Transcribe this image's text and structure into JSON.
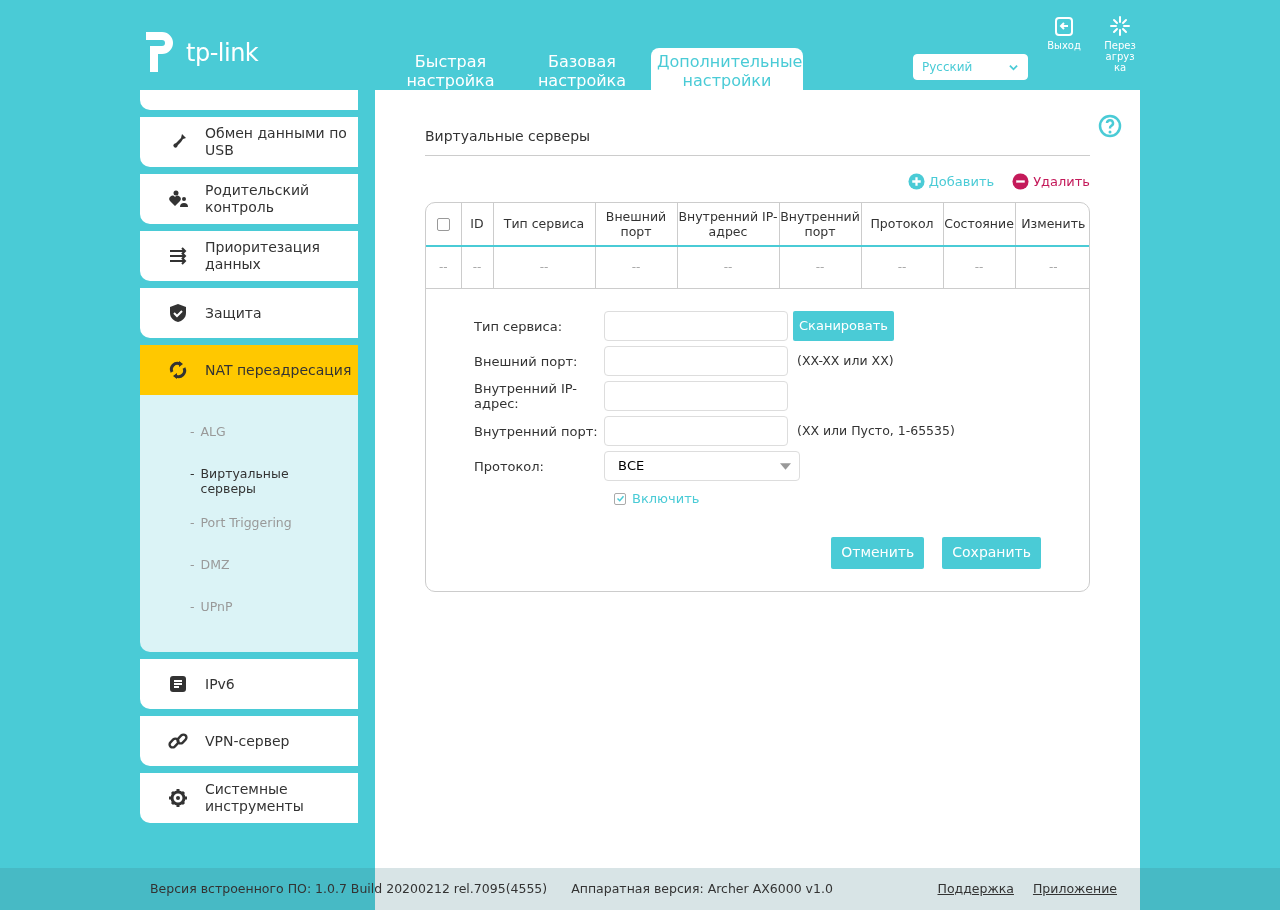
{
  "header": {
    "logo": "tp-link",
    "tabs": [
      {
        "label": "Быстрая настройка",
        "selected": false
      },
      {
        "label": "Базовая настройка",
        "selected": false
      },
      {
        "label": "Дополнительные настройки",
        "selected": true
      }
    ],
    "language": "Русский",
    "actions": [
      {
        "label": "Выход",
        "kind": "logout"
      },
      {
        "label": "Перезагрузка",
        "kind": "reboot"
      }
    ]
  },
  "sidebar": {
    "clipped_top_item": true,
    "items": [
      {
        "label": "Обмен данными по USB",
        "selected": false
      },
      {
        "label": "Родительский контроль",
        "selected": false
      },
      {
        "label": "Приоритезация данных",
        "selected": false
      },
      {
        "label": "Защита",
        "selected": false
      },
      {
        "label": "NAT переадресация",
        "selected": true,
        "children": [
          {
            "dash": "-",
            "label": "ALG",
            "selected": false
          },
          {
            "dash": "-",
            "label": "Виртуальные серверы",
            "selected": true
          },
          {
            "dash": "-",
            "label": "Port Triggering",
            "selected": false
          },
          {
            "dash": "-",
            "label": "DMZ",
            "selected": false
          },
          {
            "dash": "-",
            "label": "UPnP",
            "selected": false
          }
        ]
      },
      {
        "label": "IPv6",
        "selected": false
      },
      {
        "label": "VPN-сервер",
        "selected": false
      },
      {
        "label": "Системные инструменты",
        "selected": false
      }
    ]
  },
  "content": {
    "title": "Виртуальные серверы",
    "actions": [
      {
        "label": "Добавить",
        "kind": "add"
      },
      {
        "label": "Удалить",
        "kind": "delete"
      }
    ],
    "table": {
      "select_all_checked": false,
      "columns": [
        "ID",
        "Тип сервиса",
        "Внешний порт",
        "Внутренний IP-адрес",
        "Внутренний порт",
        "Протокол",
        "Состояние",
        "Изменить"
      ],
      "rows": [
        {
          "checkbox": "--",
          "cells": [
            "--",
            "--",
            "--",
            "--",
            "--",
            "--",
            "--",
            "--"
          ]
        }
      ]
    },
    "form": {
      "fields": [
        {
          "label": "Тип сервиса:",
          "kind": "text",
          "button": "Сканировать"
        },
        {
          "label": "Внешний порт:",
          "kind": "text",
          "hint": "(XX-XX или XX)"
        },
        {
          "label": "Внутренний IP-адрес:",
          "kind": "text"
        },
        {
          "label": "Внутренний порт:",
          "kind": "text",
          "hint": "(XX или Пусто, 1-65535)"
        },
        {
          "label": "Протокол:",
          "kind": "select",
          "value": "ВСЕ"
        }
      ],
      "enable": {
        "label": "Включить",
        "checked": true
      },
      "buttons": [
        "Отменить",
        "Сохранить"
      ]
    }
  },
  "footer": {
    "firmware": "Версия встроенного ПО: 1.0.7 Build 20200212 rel.7095(4555)",
    "hardware": "Аппаратная версия: Archer AX6000 v1.0",
    "links": [
      "Поддержка",
      "Приложение"
    ]
  }
}
